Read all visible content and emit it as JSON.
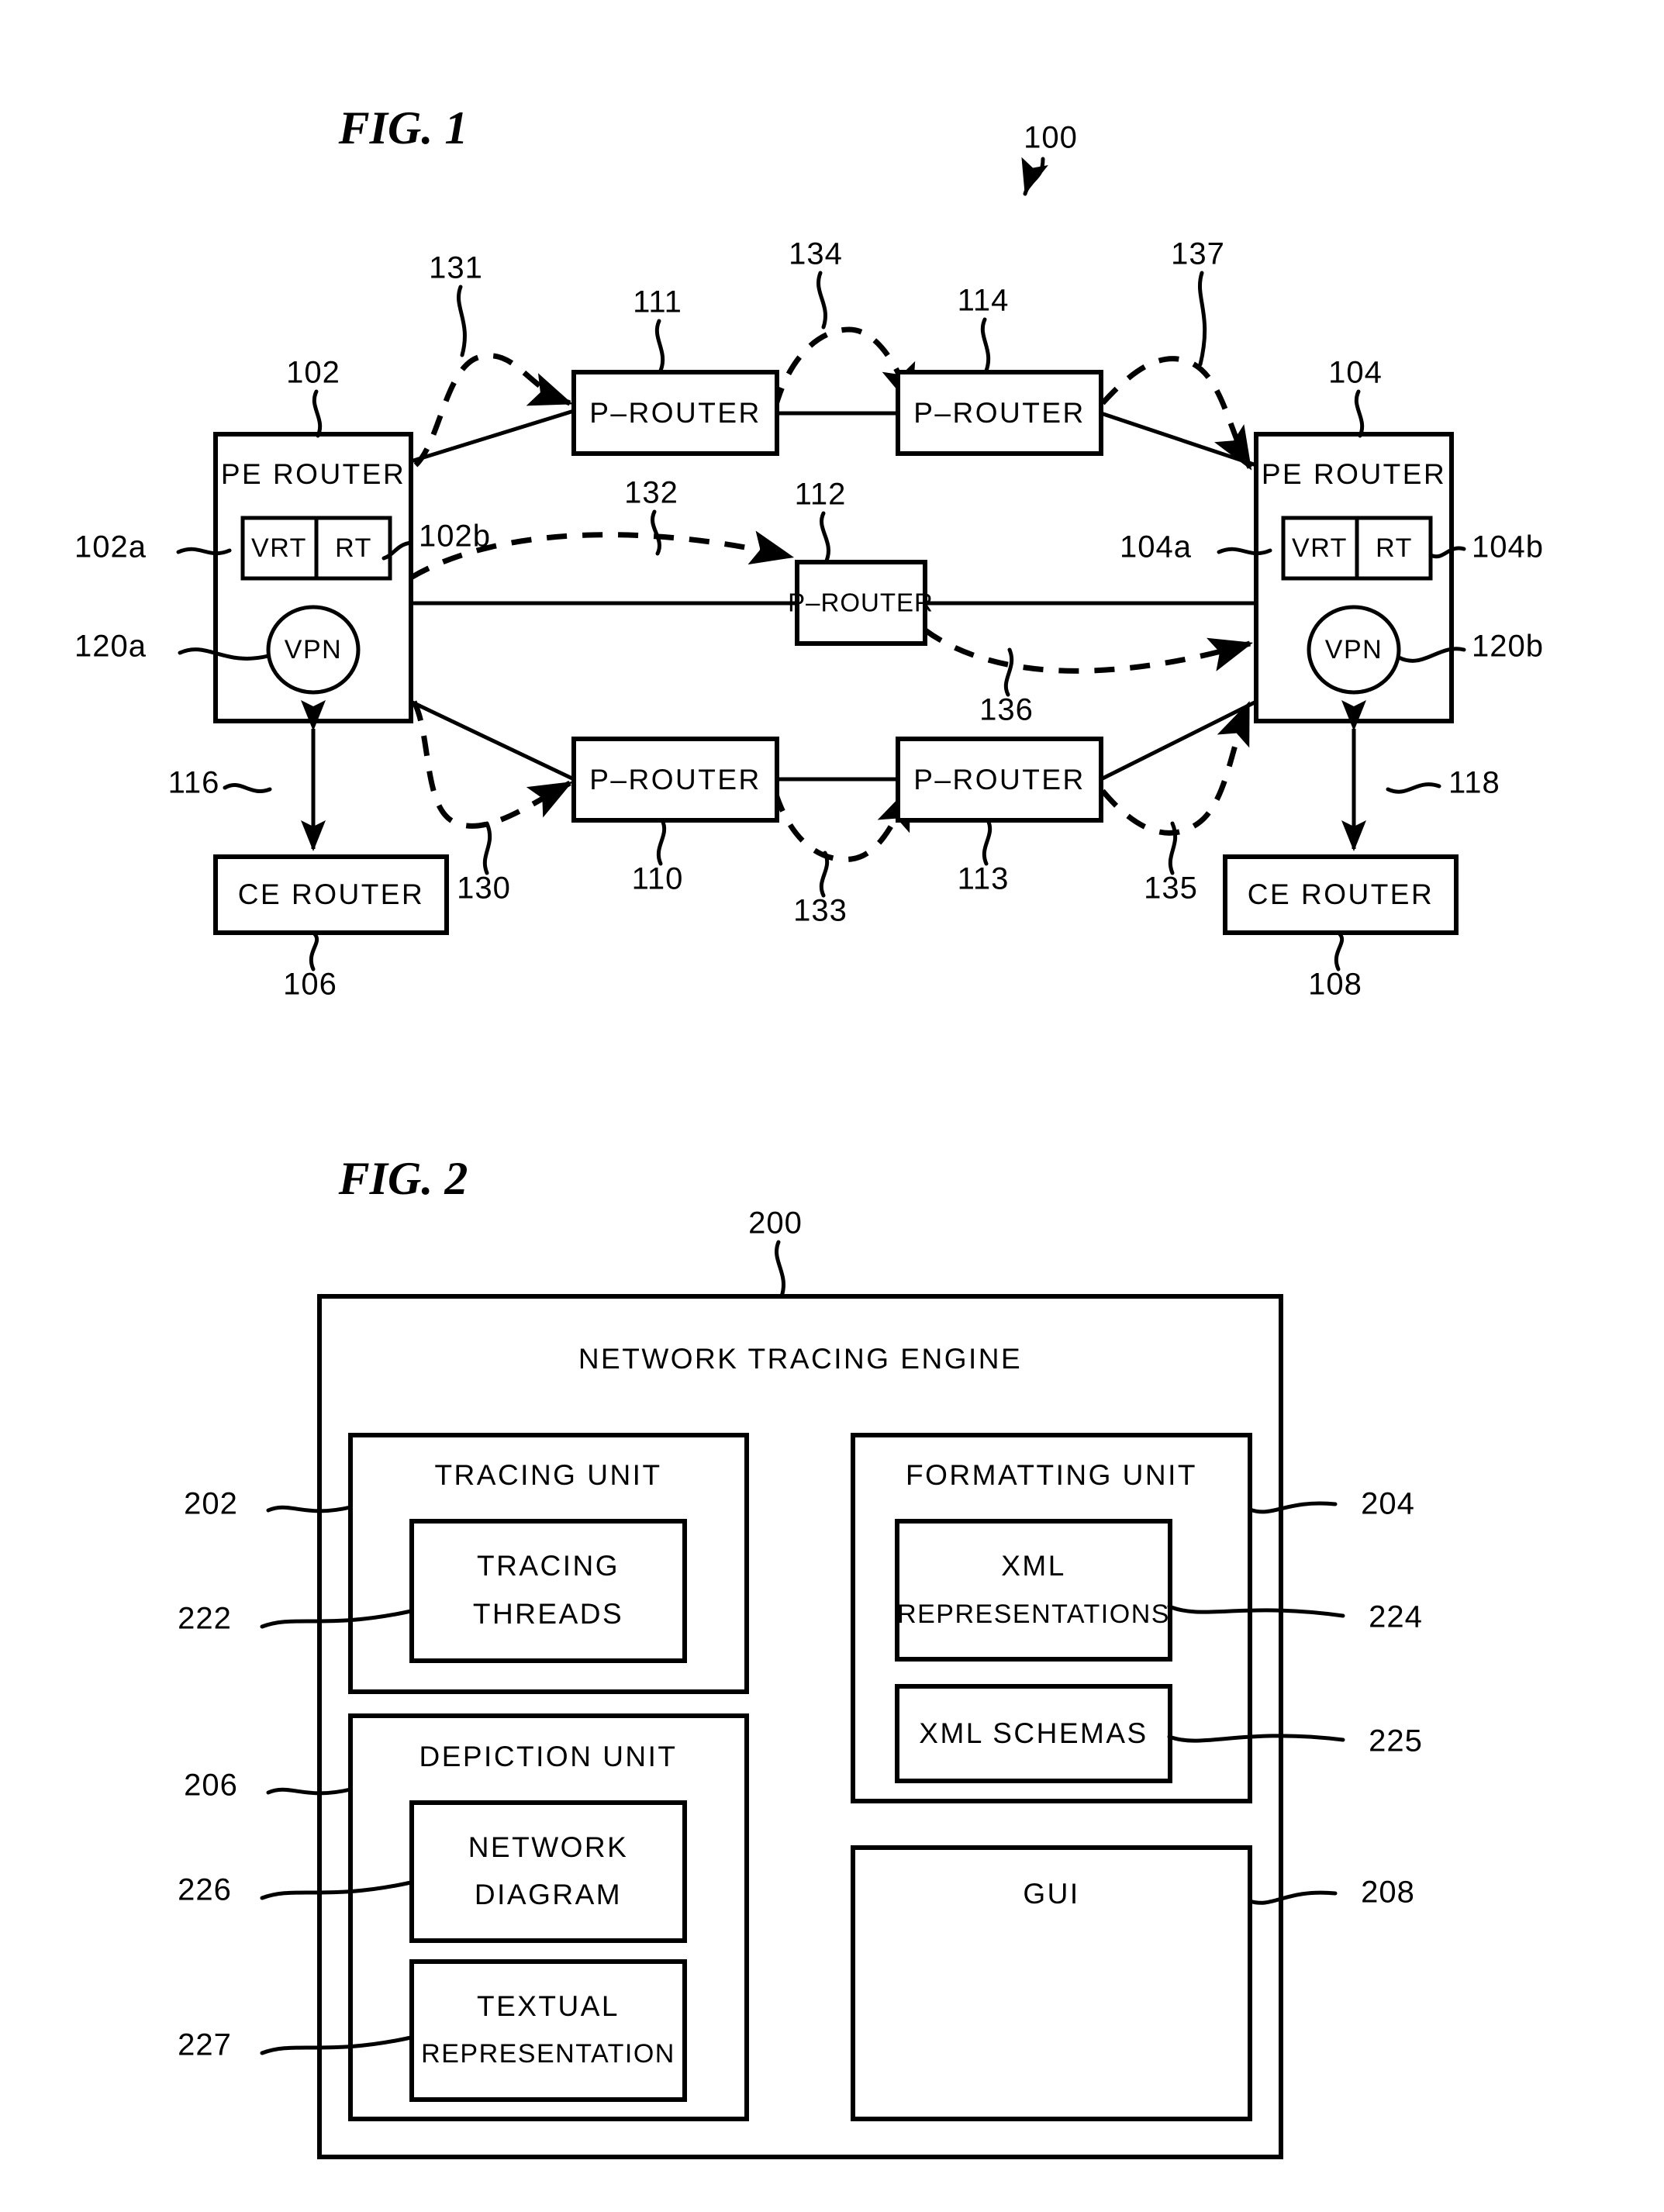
{
  "figures": [
    {
      "id": "fig1",
      "title": "FIG. 1",
      "system_ref": "100",
      "nodes": {
        "pe_left": {
          "label": "PE  ROUTER",
          "ref": "102"
        },
        "pe_right": {
          "label": "PE  ROUTER",
          "ref": "104"
        },
        "ce_left": {
          "label": "CE  ROUTER",
          "ref": "106"
        },
        "ce_right": {
          "label": "CE  ROUTER",
          "ref": "108"
        },
        "p_top_left": {
          "label": "P–ROUTER",
          "ref": "111"
        },
        "p_top_right": {
          "label": "P–ROUTER",
          "ref": "114"
        },
        "p_mid": {
          "label": "P–ROUTER",
          "ref": "112"
        },
        "p_bot_left": {
          "label": "P–ROUTER",
          "ref": "110"
        },
        "p_bot_right": {
          "label": "P–ROUTER",
          "ref": "113"
        }
      },
      "sub_elements": {
        "vrt_left": {
          "label": "VRT",
          "ref": "102a"
        },
        "rt_left": {
          "label": "RT",
          "ref": "102b"
        },
        "vpn_left": {
          "label": "VPN",
          "ref": "120a"
        },
        "vrt_right": {
          "label": "VRT",
          "ref": "104a"
        },
        "rt_right": {
          "label": "RT",
          "ref": "104b"
        },
        "vpn_right": {
          "label": "VPN",
          "ref": "120b"
        }
      },
      "link_refs": {
        "pe_ce_left": "116",
        "pe_ce_right": "118"
      },
      "trace_refs": {
        "t130": "130",
        "t131": "131",
        "t132": "132",
        "t133": "133",
        "t134": "134",
        "t135": "135",
        "t136": "136",
        "t137": "137"
      }
    },
    {
      "id": "fig2",
      "title": "FIG. 2",
      "engine": {
        "label": "NETWORK  TRACING  ENGINE",
        "ref": "200"
      },
      "units": [
        {
          "label": "TRACING  UNIT",
          "ref": "202",
          "children": [
            {
              "label": "TRACING\nTHREADS",
              "ref": "222"
            }
          ]
        },
        {
          "label": "DEPICTION  UNIT",
          "ref": "206",
          "children": [
            {
              "label": "NETWORK\nDIAGRAM",
              "ref": "226"
            },
            {
              "label": "TEXTUAL\nREPRESENTATION",
              "ref": "227"
            }
          ]
        },
        {
          "label": "FORMATTING  UNIT",
          "ref": "204",
          "children": [
            {
              "label": "XML\nREPRESENTATIONS",
              "ref": "224"
            },
            {
              "label": "XML  SCHEMAS",
              "ref": "225"
            }
          ]
        },
        {
          "label": "GUI",
          "ref": "208",
          "children": []
        }
      ]
    }
  ],
  "labels": {
    "fig1_title": "FIG. 1",
    "fig2_title": "FIG. 2",
    "ref_100": "100",
    "ref_102": "102",
    "ref_104": "104",
    "ref_106": "106",
    "ref_108": "108",
    "ref_110": "110",
    "ref_111": "111",
    "ref_112": "112",
    "ref_113": "113",
    "ref_114": "114",
    "ref_116": "116",
    "ref_118": "118",
    "ref_102a": "102a",
    "ref_102b": "102b",
    "ref_104a": "104a",
    "ref_104b": "104b",
    "ref_120a": "120a",
    "ref_120b": "120b",
    "ref_130": "130",
    "ref_131": "131",
    "ref_132": "132",
    "ref_133": "133",
    "ref_134": "134",
    "ref_135": "135",
    "ref_136": "136",
    "ref_137": "137",
    "ref_200": "200",
    "ref_202": "202",
    "ref_204": "204",
    "ref_206": "206",
    "ref_208": "208",
    "ref_222": "222",
    "ref_224": "224",
    "ref_225": "225",
    "ref_226": "226",
    "ref_227": "227",
    "pe_router": "PE  ROUTER",
    "ce_router": "CE  ROUTER",
    "p_router": "P–ROUTER",
    "vrt": "VRT",
    "rt": "RT",
    "vpn": "VPN",
    "engine_title": "NETWORK  TRACING  ENGINE",
    "tracing_unit": "TRACING  UNIT",
    "tracing_threads_1": "TRACING",
    "tracing_threads_2": "THREADS",
    "depiction_unit": "DEPICTION  UNIT",
    "network_diagram_1": "NETWORK",
    "network_diagram_2": "DIAGRAM",
    "textual_rep_1": "TEXTUAL",
    "textual_rep_2": "REPRESENTATION",
    "formatting_unit": "FORMATTING  UNIT",
    "xml_rep_1": "XML",
    "xml_rep_2": "REPRESENTATIONS",
    "xml_schemas": "XML  SCHEMAS",
    "gui": "GUI"
  },
  "colors": {
    "ink": "#000000",
    "paper": "#ffffff"
  }
}
